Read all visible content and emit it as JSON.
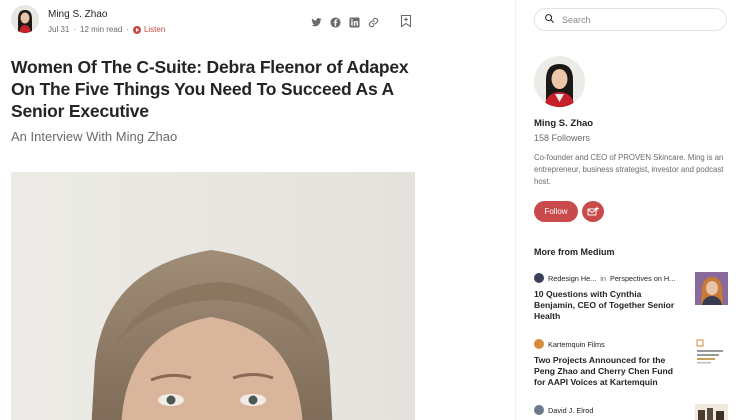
{
  "article": {
    "author": "Ming S. Zhao",
    "date": "Jul 31",
    "read_time": "12 min read",
    "dot": "·",
    "listen_label": "Listen",
    "title": "Women Of The C-Suite: Debra Fleenor of Adapex On The Five Things You Need To Succeed As A Senior Executive",
    "subtitle": "An Interview With Ming Zhao",
    "share_icons": [
      "twitter-icon",
      "facebook-icon",
      "linkedin-icon",
      "link-icon"
    ],
    "bookmark_icon": "bookmark-icon"
  },
  "sidebar": {
    "search_placeholder": "Search",
    "author_name": "Ming S. Zhao",
    "followers": "158 Followers",
    "bio": "Co-founder and CEO of PROVEN Skincare. Ming is an entrepreneur, business strategist, investor and podcast host.",
    "follow_label": "Follow",
    "more_heading": "More from Medium",
    "recommendations": [
      {
        "source": "Redesign He...",
        "in_label": "in",
        "publication": "Perspectives on H...",
        "title": "10 Questions with Cynthia Benjamin, CEO of Together Senior Health"
      },
      {
        "source": "Kartemquin Films",
        "title": "Two Projects Announced for the Peng Zhao and Cherry Chen Fund for AAPI Voices at Kartemquin"
      },
      {
        "source": "David J. Elrod",
        "title": ""
      }
    ]
  },
  "colors": {
    "accent": "#c94a4a",
    "text": "#242424",
    "muted": "#6b6b6b"
  }
}
